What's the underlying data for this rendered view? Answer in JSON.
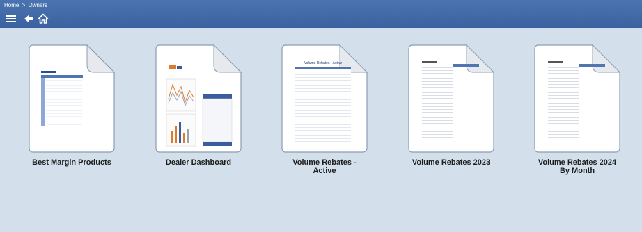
{
  "breadcrumb": {
    "home": "Home",
    "separator": ">",
    "current": "Owners"
  },
  "toolbar": {
    "menu_icon": "hamburger-menu-icon",
    "back_icon": "back-arrow-icon",
    "home_icon": "home-icon"
  },
  "colors": {
    "topbar": "#3d66a5",
    "background": "#d3e0ec",
    "tile_border": "#9aa9b8",
    "caption": "#1e1e1e"
  },
  "reports": [
    {
      "title": "Best Margin Products"
    },
    {
      "title": "Dealer Dashboard"
    },
    {
      "title": "Volume Rebates -\nActive",
      "preview_heading": "Volume Rebates - Active"
    },
    {
      "title": "Volume Rebates 2023"
    },
    {
      "title": "Volume Rebates 2024\nBy Month"
    }
  ]
}
